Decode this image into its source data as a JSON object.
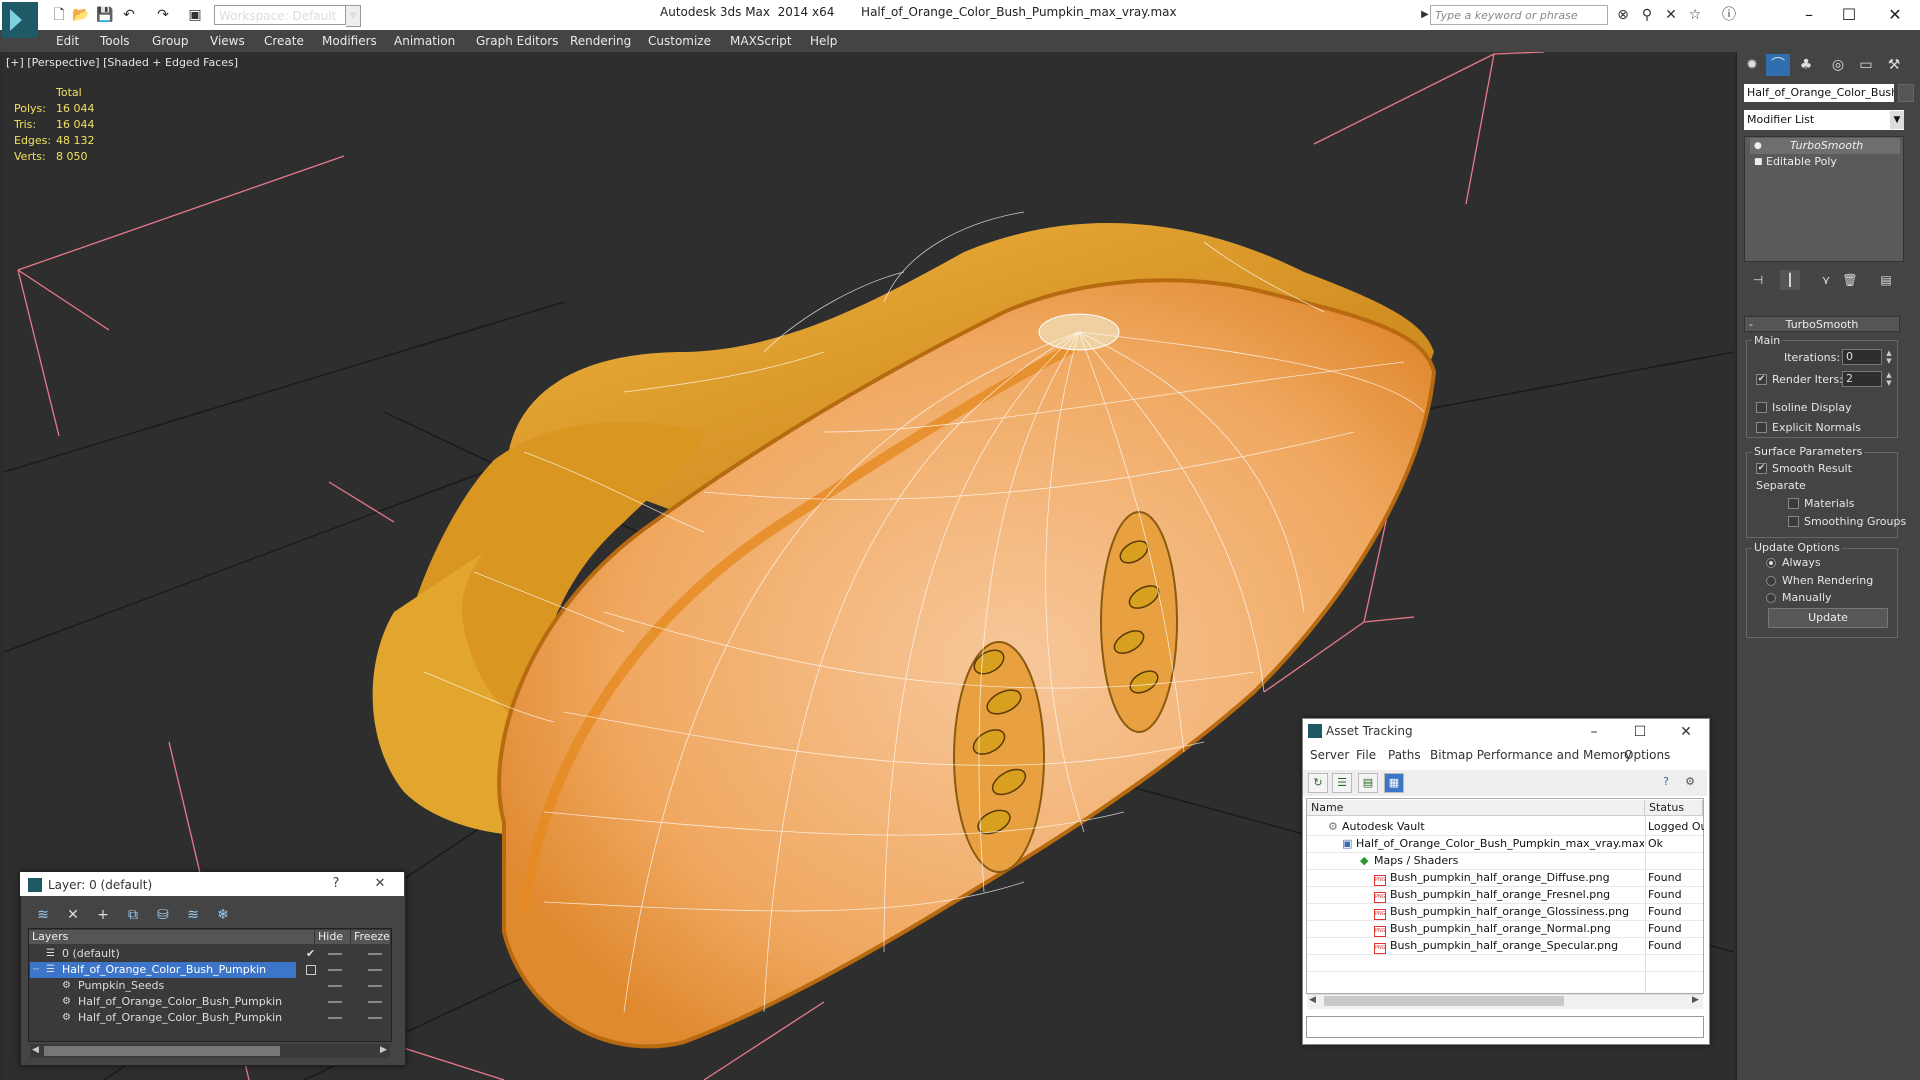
{
  "titlebar": {
    "workspace": "Workspace: Default",
    "title": "Autodesk 3ds Max  2014 x64       Half_of_Orange_Color_Bush_Pumpkin_max_vray.max",
    "search_placeholder": "Type a keyword or phrase"
  },
  "menu": [
    "Edit",
    "Tools",
    "Group",
    "Views",
    "Create",
    "Modifiers",
    "Animation",
    "Graph Editors",
    "Rendering",
    "Customize",
    "MAXScript",
    "Help"
  ],
  "viewport": {
    "label": "[+] [Perspective] [Shaded + Edged Faces]",
    "stats": {
      "header": "Total",
      "rows": [
        {
          "label": "Polys:",
          "value": "16 044"
        },
        {
          "label": "Tris:",
          "value": "16 044"
        },
        {
          "label": "Edges:",
          "value": "48 132"
        },
        {
          "label": "Verts:",
          "value": "8 050"
        }
      ]
    }
  },
  "command_panel": {
    "object_name": "Half_of_Orange_Color_Bush_",
    "modifier_list": "Modifier List",
    "stack": [
      "TurboSmooth",
      "Editable Poly"
    ],
    "turbosmooth": {
      "header": "TurboSmooth",
      "main_group": "Main",
      "iterations_label": "Iterations:",
      "iterations_value": "0",
      "render_iters_label": "Render Iters:",
      "render_iters_value": "2",
      "isoline_label": "Isoline Display",
      "explicit_normals_label": "Explicit Normals",
      "surface_group": "Surface Parameters",
      "smooth_result_label": "Smooth Result",
      "separate_label": "Separate",
      "materials_label": "Materials",
      "smoothing_groups_label": "Smoothing Groups",
      "update_group": "Update Options",
      "always_label": "Always",
      "when_rendering_label": "When Rendering",
      "manually_label": "Manually",
      "update_button": "Update"
    }
  },
  "asset_tracking": {
    "title": "Asset Tracking",
    "menu": [
      "Server",
      "File",
      "Paths",
      "Bitmap Performance and Memory",
      "Options"
    ],
    "columns": {
      "name": "Name",
      "status": "Status"
    },
    "rows": [
      {
        "name": "Autodesk Vault",
        "status": "Logged Ou"
      },
      {
        "name": "Half_of_Orange_Color_Bush_Pumpkin_max_vray.max",
        "status": "Ok"
      },
      {
        "name": "Maps / Shaders",
        "status": ""
      },
      {
        "name": "Bush_pumpkin_half_orange_Diffuse.png",
        "status": "Found"
      },
      {
        "name": "Bush_pumpkin_half_orange_Fresnel.png",
        "status": "Found"
      },
      {
        "name": "Bush_pumpkin_half_orange_Glossiness.png",
        "status": "Found"
      },
      {
        "name": "Bush_pumpkin_half_orange_Normal.png",
        "status": "Found"
      },
      {
        "name": "Bush_pumpkin_half_orange_Specular.png",
        "status": "Found"
      }
    ]
  },
  "layer_dialog": {
    "title": "Layer: 0 (default)",
    "help": "?",
    "columns": {
      "layers": "Layers",
      "hide": "Hide",
      "freeze": "Freeze"
    },
    "rows": [
      {
        "name": "0 (default)"
      },
      {
        "name": "Half_of_Orange_Color_Bush_Pumpkin"
      },
      {
        "name": "Pumpkin_Seeds"
      },
      {
        "name": "Half_of_Orange_Color_Bush_Pumpkin"
      },
      {
        "name": "Half_of_Orange_Color_Bush_Pumpkin"
      }
    ]
  },
  "colors": {
    "accent_selection": "#3d76c8",
    "pumpkin_skin": "#e0a020",
    "pumpkin_flesh": "#f2a860",
    "stats_text": "#f0e060"
  }
}
